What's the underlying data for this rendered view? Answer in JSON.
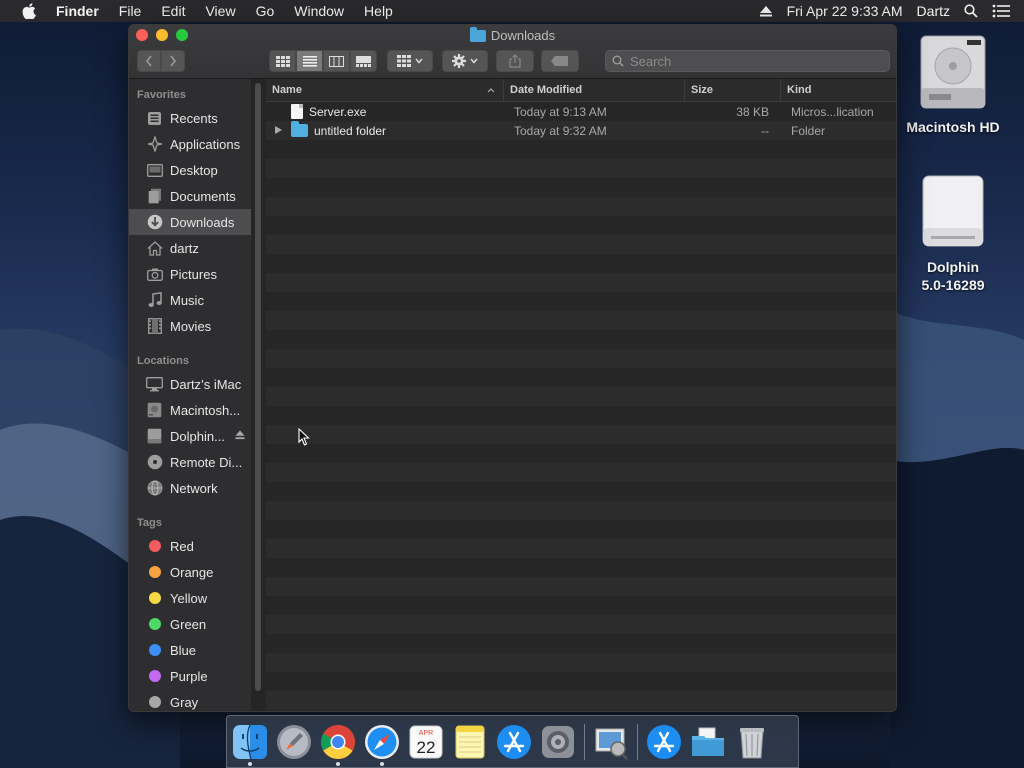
{
  "menubar": {
    "app_name": "Finder",
    "menus": [
      "File",
      "Edit",
      "View",
      "Go",
      "Window",
      "Help"
    ],
    "datetime": "Fri Apr 22  9:33 AM",
    "user": "Dartz"
  },
  "window": {
    "title": "Downloads",
    "search_placeholder": "Search"
  },
  "sidebar": {
    "favorites_header": "Favorites",
    "favorites": [
      {
        "label": "Recents",
        "icon": "recents-icon"
      },
      {
        "label": "Applications",
        "icon": "applications-icon"
      },
      {
        "label": "Desktop",
        "icon": "desktop-icon"
      },
      {
        "label": "Documents",
        "icon": "documents-icon"
      },
      {
        "label": "Downloads",
        "icon": "downloads-icon",
        "selected": true
      },
      {
        "label": "dartz",
        "icon": "home-icon"
      },
      {
        "label": "Pictures",
        "icon": "pictures-icon"
      },
      {
        "label": "Music",
        "icon": "music-icon"
      },
      {
        "label": "Movies",
        "icon": "movies-icon"
      }
    ],
    "locations_header": "Locations",
    "locations": [
      {
        "label": "Dartz’s iMac",
        "icon": "computer-icon"
      },
      {
        "label": "Macintosh...",
        "icon": "hard-drive-icon"
      },
      {
        "label": "Dolphin...",
        "icon": "disk-image-icon"
      },
      {
        "label": "Remote Di...",
        "icon": "remote-disc-icon"
      },
      {
        "label": "Network",
        "icon": "network-icon"
      }
    ],
    "tags_header": "Tags",
    "tags": [
      {
        "label": "Red",
        "color": "#f25c5c"
      },
      {
        "label": "Orange",
        "color": "#f4a340"
      },
      {
        "label": "Yellow",
        "color": "#f5d844"
      },
      {
        "label": "Green",
        "color": "#4cd964"
      },
      {
        "label": "Blue",
        "color": "#3c8ef5"
      },
      {
        "label": "Purple",
        "color": "#c36af0"
      },
      {
        "label": "Gray",
        "color": "#a8a8a8"
      }
    ]
  },
  "filelist": {
    "columns": {
      "name": "Name",
      "date": "Date Modified",
      "size": "Size",
      "kind": "Kind"
    },
    "rows": [
      {
        "name": "Server.exe",
        "date": "Today at 9:13 AM",
        "size": "38 KB",
        "kind": "Micros...lication",
        "type": "file"
      },
      {
        "name": "untitled folder",
        "date": "Today at 9:32 AM",
        "size": "--",
        "kind": "Folder",
        "type": "folder"
      }
    ]
  },
  "desktop": {
    "icons": [
      {
        "label": "Macintosh HD"
      },
      {
        "label_line1": "Dolphin",
        "label_line2": "5.0-16289"
      }
    ]
  },
  "dock": {
    "apps": [
      "finder-icon",
      "launchpad-icon",
      "chrome-icon",
      "safari-icon",
      "calendar-icon",
      "notes-icon",
      "app-store-icon",
      "system-preferences-icon",
      "preview-icon",
      "app-store-icon",
      "downloads-folder-icon",
      "trash-icon"
    ],
    "calendar_month": "APR",
    "calendar_day": "22"
  },
  "colors": {
    "selection": "#4d4d50",
    "folder_blue": "#4fb0e2",
    "window_bg": "#252525"
  }
}
